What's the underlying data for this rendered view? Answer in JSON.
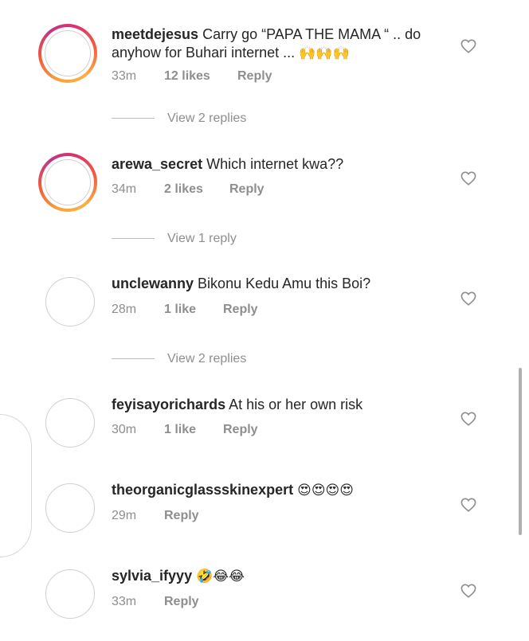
{
  "comments": [
    {
      "username": "meetdejesus",
      "text": "Carry go “PAPA THE MAMA “ .. do anyhow for Buhari internet ... ",
      "emoji": "🙌🙌🙌",
      "time": "33m",
      "likes": "12 likes",
      "reply": "Reply",
      "view_replies": "View 2 replies"
    },
    {
      "username": "arewa_secret",
      "text": "Which internet kwa??",
      "time": "34m",
      "likes": "2 likes",
      "reply": "Reply",
      "view_replies": "View 1 reply"
    },
    {
      "username": "unclewanny",
      "text": "Bikonu Kedu Amu this Boi?",
      "time": "28m",
      "likes": "1 like",
      "reply": "Reply",
      "view_replies": "View 2 replies"
    },
    {
      "username": "feyisayorichards",
      "text": "At his or her own risk",
      "time": "30m",
      "likes": "1 like",
      "reply": "Reply"
    },
    {
      "username": "theorganicglassskinexpert",
      "text": "",
      "emoji": "😍😍😍😍",
      "time": "29m",
      "reply": "Reply"
    },
    {
      "username": "sylvia_ifyyy",
      "text": "",
      "emoji": "🤣😂😂",
      "time": "33m",
      "reply": "Reply"
    }
  ],
  "icons": {
    "heart": "heart-outline-icon",
    "avatar_ring_colors": [
      "#f9a23a",
      "#e1306c",
      "#c13584"
    ]
  }
}
